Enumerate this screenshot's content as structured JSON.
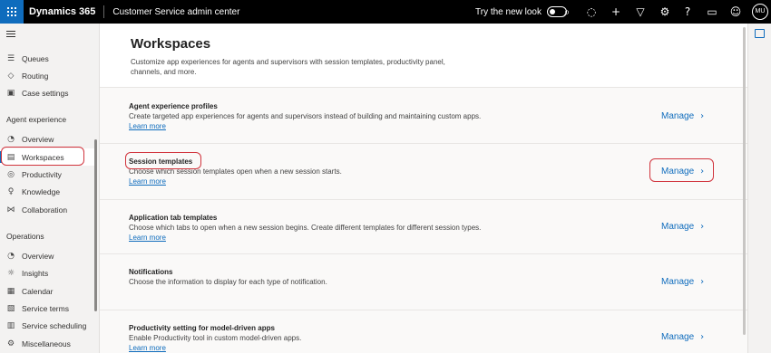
{
  "header": {
    "brand": "Dynamics 365",
    "app_title": "Customer Service admin center",
    "try_new_look": "Try the new look",
    "avatar_initials": "MU",
    "icons": [
      "search-icon",
      "lightbulb-icon",
      "add-icon",
      "filter-icon",
      "settings-icon",
      "help-icon",
      "chat-icon",
      "smiley-icon"
    ]
  },
  "nav": {
    "items_top": [
      {
        "label": "Queues",
        "icon": "queues-icon"
      },
      {
        "label": "Routing",
        "icon": "routing-icon"
      },
      {
        "label": "Case settings",
        "icon": "case-settings-icon"
      }
    ],
    "group_agent": "Agent experience",
    "items_agent": [
      {
        "label": "Overview",
        "icon": "overview-icon"
      },
      {
        "label": "Workspaces",
        "icon": "workspaces-icon"
      },
      {
        "label": "Productivity",
        "icon": "productivity-icon"
      },
      {
        "label": "Knowledge",
        "icon": "knowledge-icon"
      },
      {
        "label": "Collaboration",
        "icon": "collaboration-icon"
      }
    ],
    "group_operations": "Operations",
    "items_operations": [
      {
        "label": "Overview",
        "icon": "overview-icon"
      },
      {
        "label": "Insights",
        "icon": "insights-icon"
      },
      {
        "label": "Calendar",
        "icon": "calendar-icon"
      },
      {
        "label": "Service terms",
        "icon": "service-terms-icon"
      },
      {
        "label": "Service scheduling",
        "icon": "service-scheduling-icon"
      },
      {
        "label": "Miscellaneous",
        "icon": "miscellaneous-icon"
      }
    ],
    "selected": "Workspaces"
  },
  "page": {
    "title": "Workspaces",
    "description": "Customize app experiences for agents and supervisors with session templates, productivity panel, channels, and more."
  },
  "sections": [
    {
      "title": "Agent experience profiles",
      "description": "Create targeted app experiences for agents and supervisors instead of building and maintaining custom apps.",
      "link": "Learn more",
      "action": "Manage"
    },
    {
      "title": "Session templates",
      "description": "Choose which session templates open when a new session starts.",
      "link": "Learn more",
      "action": "Manage"
    },
    {
      "title": "Application tab templates",
      "description": "Choose which tabs to open when a new session begins. Create different templates for different session types.",
      "link": "Learn more",
      "action": "Manage"
    },
    {
      "title": "Notifications",
      "description": "Choose the information to display for each type of notification.",
      "link": "",
      "action": "Manage"
    },
    {
      "title": "Productivity setting for model-driven apps",
      "description": "Enable Productivity tool in custom model-driven apps.",
      "link": "Learn more",
      "action": "Manage"
    }
  ],
  "colors": {
    "accent": "#0f6cbd",
    "highlight": "#d1343d"
  }
}
